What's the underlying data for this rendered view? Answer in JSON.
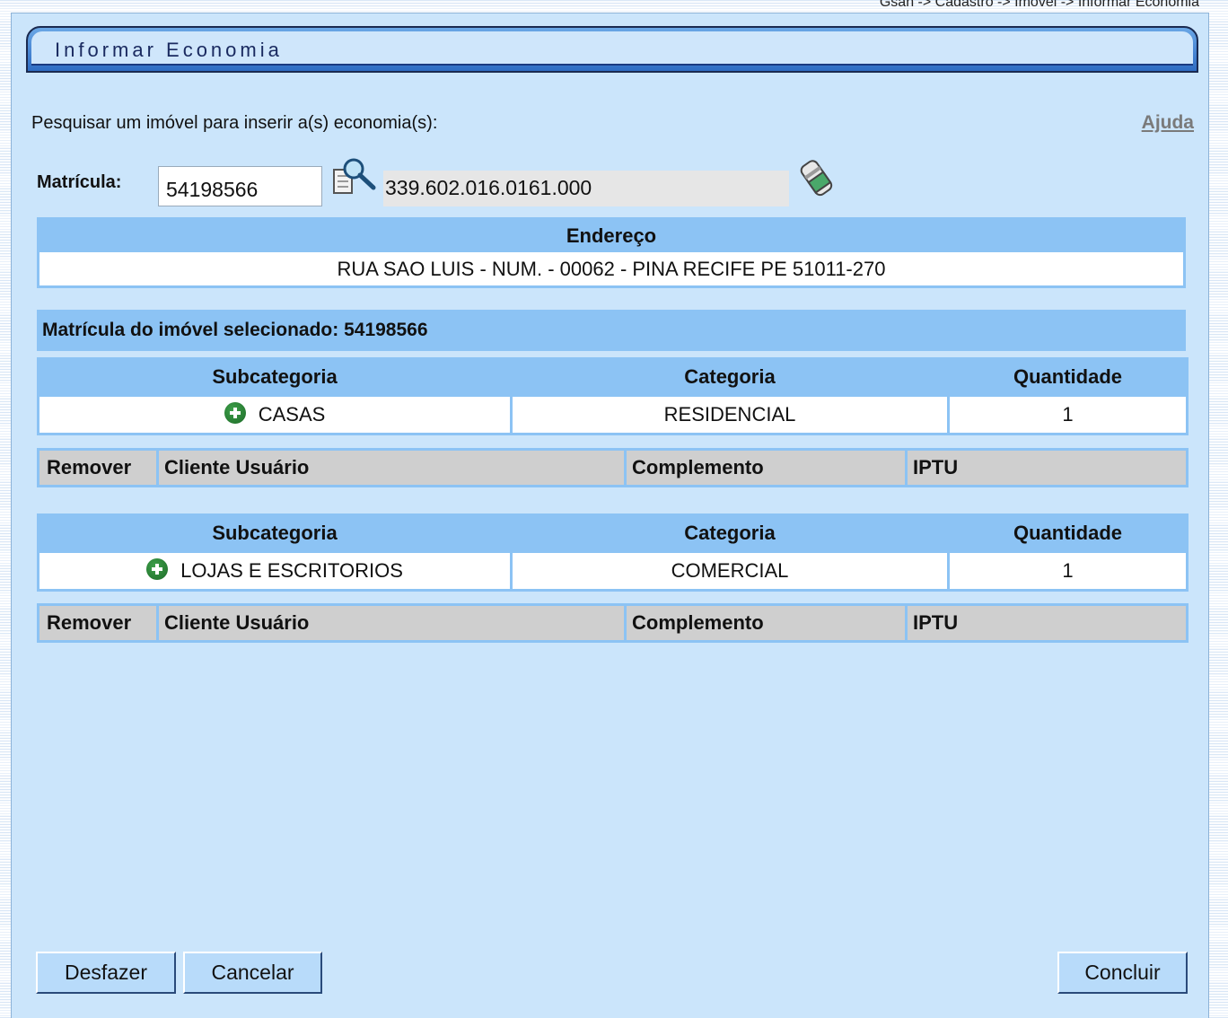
{
  "breadcrumb": "Gsan -> Cadastro -> Imovel -> Informar Economia",
  "title": "Informar Economia",
  "search": {
    "label": "Pesquisar um imóvel para inserir a(s) economia(s):",
    "help_link": "Ajuda",
    "matricula_label": "Matrícula:",
    "matricula_value": "54198566",
    "inscricao_value": "339.602.016.0161.000",
    "search_icon": "magnifier-icon",
    "clear_icon": "eraser-icon"
  },
  "endereco": {
    "header": "Endereço",
    "value": "RUA SAO LUIS - NUM. - 00062 - PINA RECIFE PE 51011-270"
  },
  "selected": {
    "text": "Matrícula do imóvel selecionado: 54198566"
  },
  "economias": [
    {
      "headers": [
        "Subcategoria",
        "Categoria",
        "Quantidade"
      ],
      "subcategoria": "CASAS",
      "categoria": "RESIDENCIAL",
      "quantidade": "1",
      "sub_headers": [
        "Remover",
        "Cliente Usuário",
        "Complemento",
        "IPTU"
      ]
    },
    {
      "headers": [
        "Subcategoria",
        "Categoria",
        "Quantidade"
      ],
      "subcategoria": "LOJAS E ESCRITORIOS",
      "categoria": "COMERCIAL",
      "quantidade": "1",
      "sub_headers": [
        "Remover",
        "Cliente Usuário",
        "Complemento",
        "IPTU"
      ]
    }
  ],
  "buttons": {
    "desfazer": "Desfazer",
    "cancelar": "Cancelar",
    "concluir": "Concluir"
  },
  "colors": {
    "panel_bg": "#cbe5fb",
    "header_blue": "#8cc3f4",
    "subheader_gray": "#cfcfcf",
    "button_bg": "#b8dbfa"
  }
}
